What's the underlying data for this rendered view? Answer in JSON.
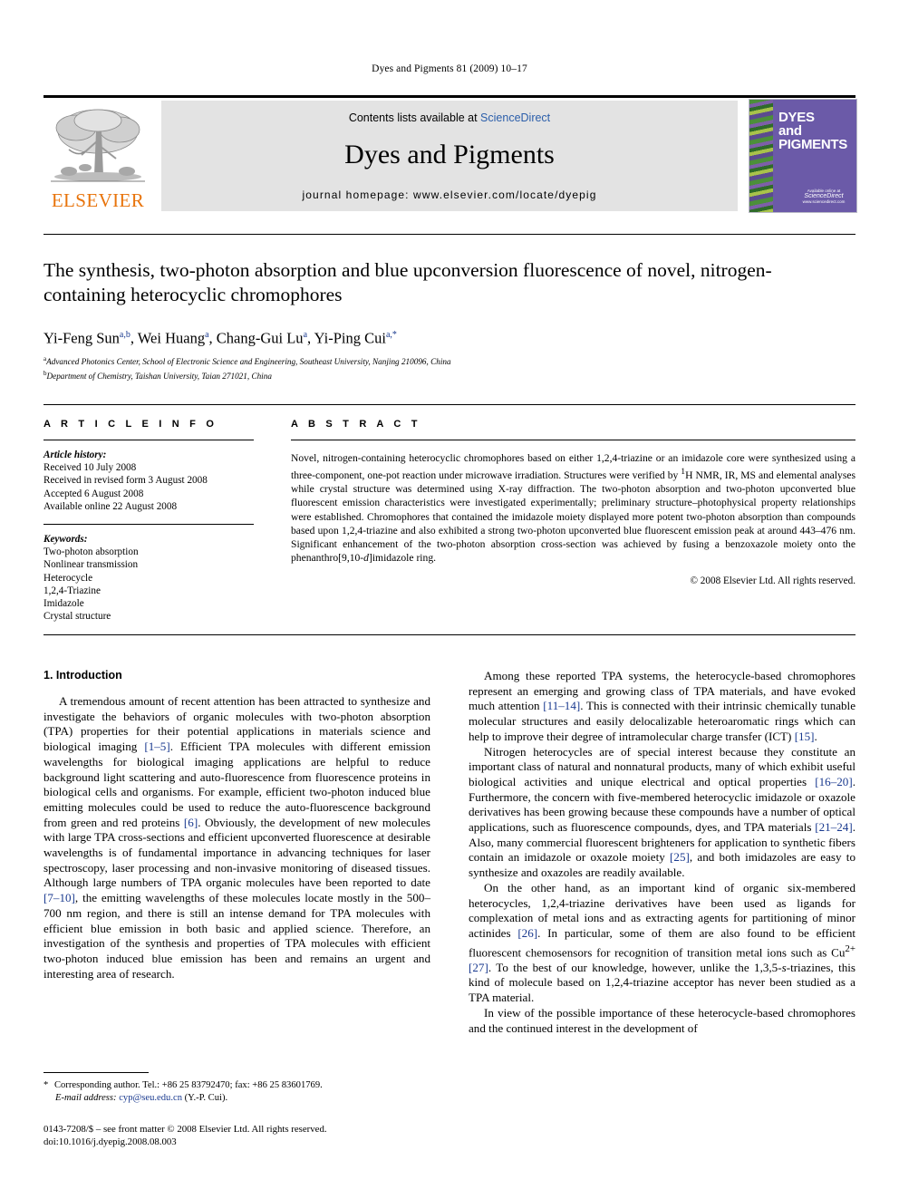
{
  "running_head": "Dyes and Pigments 81 (2009) 10–17",
  "masthead": {
    "contents_prefix": "Contents lists available at ",
    "sciencedirect": "ScienceDirect",
    "journal_title": "Dyes and Pigments",
    "homepage": "journal homepage: www.elsevier.com/locate/dyepig",
    "publisher_name": "ELSEVIER",
    "cover": {
      "line1": "DYES",
      "line2": "and",
      "line3": "PIGMENTS",
      "imprint_small": "Available online at",
      "imprint_big": "ScienceDirect",
      "imprint_url": "www.sciencedirect.com"
    }
  },
  "title": "The synthesis, two-photon absorption and blue upconversion fluorescence of novel, nitrogen-containing heterocyclic chromophores",
  "authors_html": "Yi-Feng Sun<sup>a,b</sup>, Wei Huang<sup>a</sup>, Chang-Gui Lu<sup>a</sup>, Yi-Ping Cui<sup>a,</sup><sup>*</sup>",
  "affiliations": [
    {
      "marker": "a",
      "text": "Advanced Photonics Center, School of Electronic Science and Engineering, Southeast University, Nanjing 210096, China"
    },
    {
      "marker": "b",
      "text": "Department of Chemistry, Taishan University, Taian 271021, China"
    }
  ],
  "article_info": {
    "heading": "A R T I C L E   I N F O",
    "history_label": "Article history:",
    "history": [
      "Received 10 July 2008",
      "Received in revised form 3 August 2008",
      "Accepted 6 August 2008",
      "Available online 22 August 2008"
    ],
    "keywords_label": "Keywords:",
    "keywords": [
      "Two-photon absorption",
      "Nonlinear transmission",
      "Heterocycle",
      "1,2,4-Triazine",
      "Imidazole",
      "Crystal structure"
    ]
  },
  "abstract": {
    "heading": "A B S T R A C T",
    "body_html": "Novel, nitrogen-containing heterocyclic chromophores based on either 1,2,4-triazine or an imidazole core were synthesized using a three-component, one-pot reaction under microwave irradiation. Structures were verified by <sup>1</sup>H NMR, IR, MS and elemental analyses while crystal structure was determined using X-ray diffraction. The two-photon absorption and two-photon upconverted blue fluorescent emission characteristics were investigated experimentally; preliminary structure–photophysical property relationships were established. Chromophores that contained the imidazole moiety displayed more potent two-photon absorption than compounds based upon 1,2,4-triazine and also exhibited a strong two-photon upconverted blue fluorescent emission peak at around 443–476 nm. Significant enhancement of the two-photon absorption cross-section was achieved by fusing a benzoxazole moiety onto the phenanthro[9,10-<i>d</i>]imidazole ring.",
    "copyright": "© 2008 Elsevier Ltd. All rights reserved."
  },
  "introduction": {
    "heading": "1.  Introduction",
    "left_paragraphs_html": [
      "A tremendous amount of recent attention has been attracted to synthesize and investigate the behaviors of organic molecules with two-photon absorption (TPA) properties for their potential applications in materials science and biological imaging <span class=\"ref\">[1–5]</span>. Efficient TPA molecules with different emission wavelengths for biological imaging applications are helpful to reduce background light scattering and auto-fluorescence from fluorescence proteins in biological cells and organisms. For example, efficient two-photon induced blue emitting molecules could be used to reduce the auto-fluorescence background from green and red proteins <span class=\"ref\">[6]</span>. Obviously, the development of new molecules with large TPA cross-sections and efficient upconverted fluorescence at desirable wavelengths is of fundamental importance in advancing techniques for laser spectroscopy, laser processing and non-invasive monitoring of diseased tissues. Although large numbers of TPA organic molecules have been reported to date <span class=\"ref\">[7–10]</span>, the emitting wavelengths of these molecules locate mostly in the 500–700 nm region, and there is still an intense demand for TPA molecules with efficient blue emission in both basic and applied science. Therefore, an investigation of the synthesis and properties of TPA molecules with efficient two-photon induced blue emission has been and remains an urgent and interesting area of research."
    ],
    "right_paragraphs_html": [
      "Among these reported TPA systems, the heterocycle-based chromophores represent an emerging and growing class of TPA materials, and have evoked much attention <span class=\"ref\">[11–14]</span>. This is connected with their intrinsic chemically tunable molecular structures and easily delocalizable heteroaromatic rings which can help to improve their degree of intramolecular charge transfer (ICT) <span class=\"ref\">[15]</span>.",
      "Nitrogen heterocycles are of special interest because they constitute an important class of natural and nonnatural products, many of which exhibit useful biological activities and unique electrical and optical properties <span class=\"ref\">[16–20]</span>. Furthermore, the concern with five-membered heterocyclic imidazole or oxazole derivatives has been growing because these compounds have a number of optical applications, such as fluorescence compounds, dyes, and TPA materials <span class=\"ref\">[21–24]</span>. Also, many commercial fluorescent brighteners for application to synthetic fibers contain an imidazole or oxazole moiety <span class=\"ref\">[25]</span>, and both imidazoles are easy to synthesize and oxazoles are readily available.",
      "On the other hand, as an important kind of organic six-membered heterocycles, 1,2,4-triazine derivatives have been used as ligands for complexation of metal ions and as extracting agents for partitioning of minor actinides <span class=\"ref\">[26]</span>. In particular, some of them are also found to be efficient fluorescent chemosensors for recognition of transition metal ions such as Cu<sup>2+</sup> <span class=\"ref\">[27]</span>. To the best of our knowledge, however, unlike the 1,3,5-<i>s</i>-triazines, this kind of molecule based on 1,2,4-triazine acceptor has never been studied as a TPA material.",
      "In view of the possible importance of these heterocycle-based chromophores and the continued interest in the development of"
    ]
  },
  "footnotes": {
    "corresponding_html": "<span class=\"star\">*</span> Corresponding author. Tel.: +86 25 83792470; fax: +86 25 83601769.",
    "email_html": "<span class=\"ital\">E-mail address:</span> <span class=\"mail\">cyp@seu.edu.cn</span> (Y.-P. Cui)."
  },
  "footer": {
    "issn_line": "0143-7208/$ – see front matter © 2008 Elsevier Ltd. All rights reserved.",
    "doi_line": "doi:10.1016/j.dyepig.2008.08.003"
  },
  "colors": {
    "elsevier_orange": "#e8740c",
    "link_blue": "#2b5eaa",
    "ref_blue": "#1a3a8f",
    "cover_purple": "#6b5aa8",
    "band_gray": "#e3e3e3"
  }
}
